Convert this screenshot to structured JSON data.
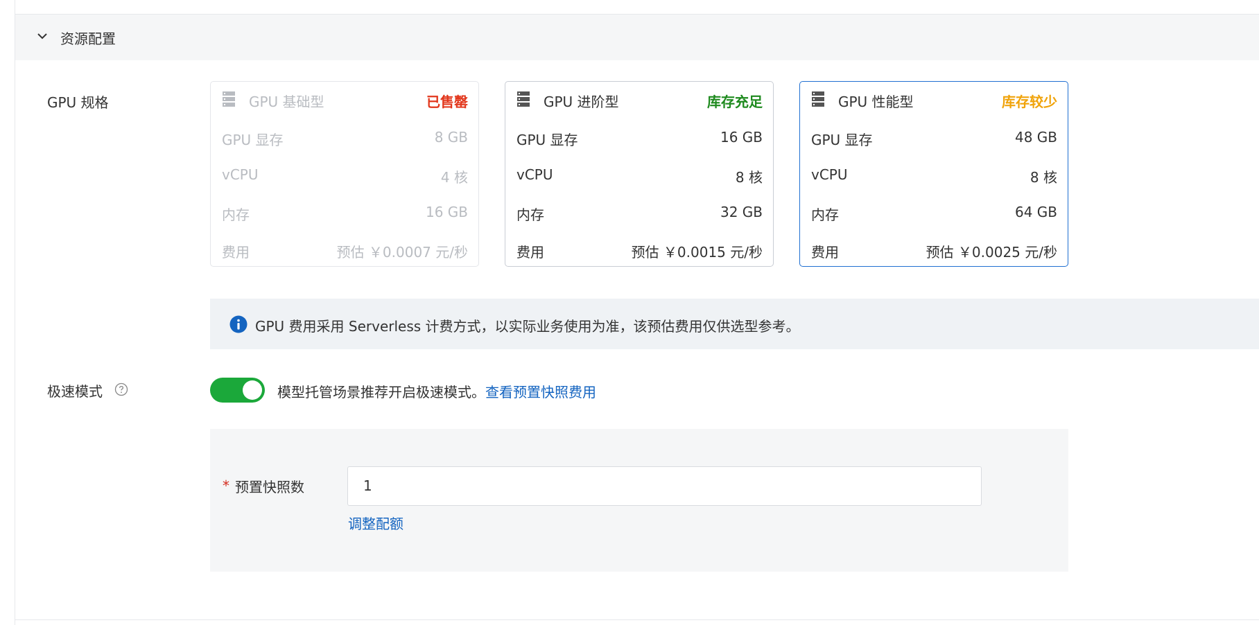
{
  "section": {
    "title": "资源配置"
  },
  "gpu_spec": {
    "label": "GPU 规格",
    "cards": [
      {
        "name": "GPU 基础型",
        "stock": "已售罄",
        "stock_color": "#e2371c",
        "state": "disabled",
        "rows": [
          {
            "key": "GPU 显存",
            "value": "8 GB"
          },
          {
            "key": "vCPU",
            "value": "4 核"
          },
          {
            "key": "内存",
            "value": "16 GB"
          },
          {
            "key": "费用",
            "value": "预估 ￥0.0007 元/秒"
          }
        ]
      },
      {
        "name": "GPU 进阶型",
        "stock": "库存充足",
        "stock_color": "#1e8a1e",
        "state": "normal",
        "rows": [
          {
            "key": "GPU 显存",
            "value": "16 GB"
          },
          {
            "key": "vCPU",
            "value": "8 核"
          },
          {
            "key": "内存",
            "value": "32 GB"
          },
          {
            "key": "费用",
            "value": "预估 ￥0.0015 元/秒"
          }
        ]
      },
      {
        "name": "GPU 性能型",
        "stock": "库存较少",
        "stock_color": "#f0a30a",
        "state": "selected",
        "rows": [
          {
            "key": "GPU 显存",
            "value": "48 GB"
          },
          {
            "key": "vCPU",
            "value": "8 核"
          },
          {
            "key": "内存",
            "value": "64 GB"
          },
          {
            "key": "费用",
            "value": "预估 ￥0.0025 元/秒"
          }
        ]
      }
    ],
    "notice": "GPU 费用采用 Serverless 计费方式，以实际业务使用为准，该预估费用仅供选型参考。"
  },
  "turbo_mode": {
    "label": "极速模式",
    "enabled": true,
    "description": "模型托管场景推荐开启极速模式。",
    "link": "查看预置快照费用"
  },
  "snapshot": {
    "required_mark": "*",
    "label": "预置快照数",
    "value": "1",
    "adjust_link": "调整配额"
  },
  "colors": {
    "accent": "#1f6fd1",
    "link": "#1464c0",
    "toggle_on": "#1ba83a",
    "info_icon": "#1464c0"
  }
}
